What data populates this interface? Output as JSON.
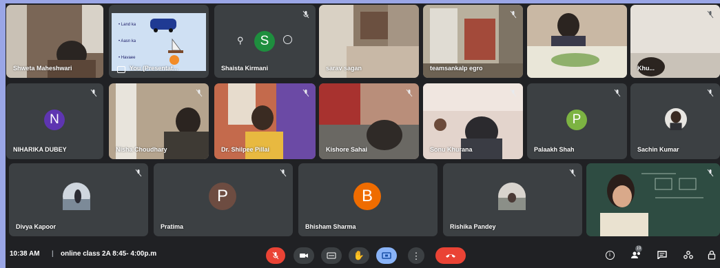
{
  "colors": {
    "background": "#202124",
    "tile": "#3c4043",
    "end_call": "#ea4335",
    "mic_muted": "#ea4335",
    "present_active": "#8ab4f8"
  },
  "tiles": {
    "t1": {
      "name": "Shweta Maheshwari"
    },
    "t2": {
      "name": "You (Presentat...",
      "slide_lines": [
        "• Land ka",
        "• Aasn ka",
        "• Havaee"
      ]
    },
    "t3": {
      "name": "Shaista Kirmani",
      "initial": "S",
      "avatar_color": "#1e8e3e"
    },
    "t4": {
      "name": "sarav sagan"
    },
    "t5": {
      "name": "teamsankalp egro"
    },
    "t6": {
      "name": ""
    },
    "t7": {
      "name": "Khu..."
    },
    "t8": {
      "name": "NIHARIKA DUBEY",
      "initial": "N",
      "avatar_color": "#5e35b1"
    },
    "t9": {
      "name": "Nisha Choudhary"
    },
    "t10": {
      "name": "Dr. Shilpee Pillai"
    },
    "t11": {
      "name": "Kishore Sahai"
    },
    "t12": {
      "name": "Sonu Khurana"
    },
    "t13": {
      "name": "Palaakh Shah",
      "initial": "P",
      "avatar_color": "#7cb342"
    },
    "t14": {
      "name": "Sachin Kumar"
    },
    "t15": {
      "name": "Divya Kapoor"
    },
    "t16": {
      "name": "Pratima",
      "initial": "P",
      "avatar_color": "#6d4c41"
    },
    "t17": {
      "name": "Bhisham Sharma",
      "initial": "B",
      "avatar_color": "#ef6c00"
    },
    "t18": {
      "name": "Rishika Pandey"
    },
    "t19": {
      "name": ""
    }
  },
  "bar": {
    "time": "10:38 AM",
    "separator": "|",
    "meeting_title": "online class 2A 8:45- 4:00p.m",
    "participants_count": "19"
  },
  "icons": {
    "mic": "mic-off-icon",
    "camera": "camera-icon",
    "captions": "captions-icon",
    "hand": "raise-hand-icon",
    "present": "present-screen-icon",
    "more": "more-options-icon",
    "end": "end-call-icon",
    "info": "info-icon",
    "people": "people-icon",
    "chat": "chat-icon",
    "activities": "activities-icon",
    "lock": "host-controls-icon"
  }
}
